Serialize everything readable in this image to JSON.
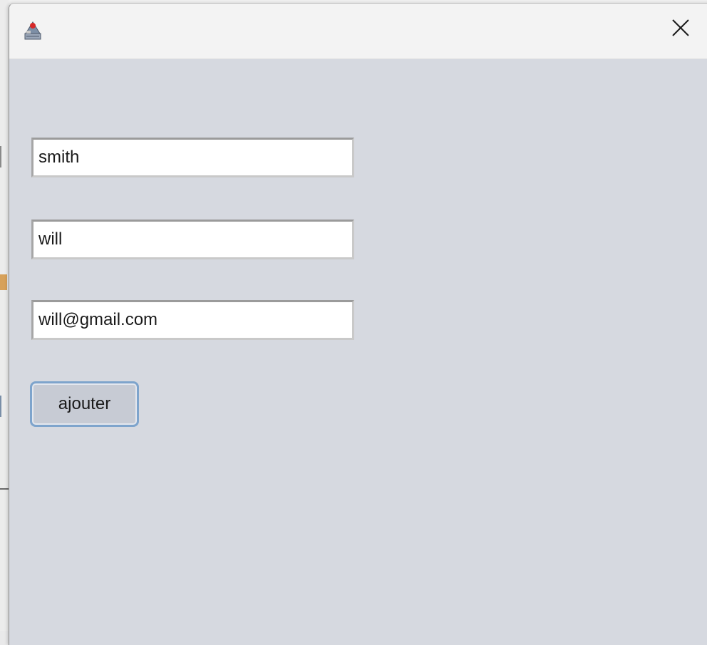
{
  "window": {
    "close_glyph": "✕"
  },
  "form": {
    "nom_value": "smith",
    "prenom_value": "will",
    "email_value": "will@gmail.com",
    "submit_label": "ajouter"
  },
  "icons": {
    "app": "java-app-icon",
    "close": "close-icon"
  },
  "colors": {
    "panel_background": "#d6d9e0",
    "titlebar_background": "#f3f3f3",
    "button_border": "#7ea4cc",
    "button_background": "#c7cbd4"
  }
}
